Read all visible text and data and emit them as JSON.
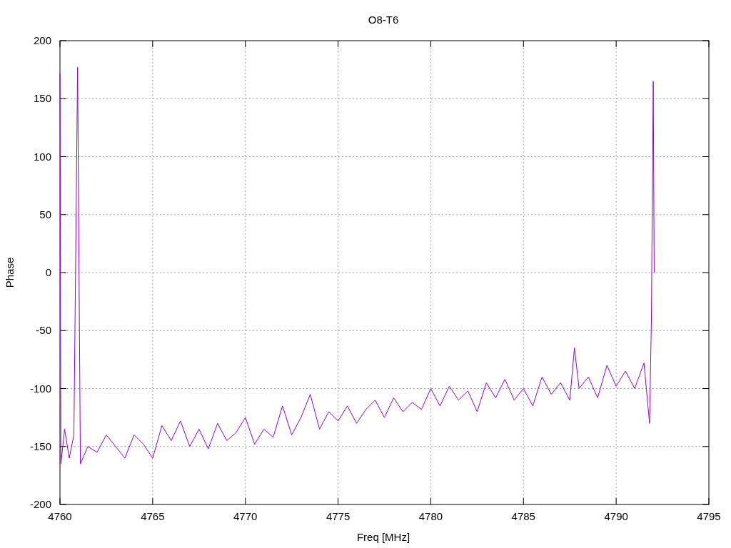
{
  "chart_data": {
    "type": "line",
    "title": "O8-T6",
    "xlabel": "Freq [MHz]",
    "ylabel": "Phase",
    "xlim": [
      4760,
      4795
    ],
    "ylim": [
      -200,
      200
    ],
    "grid": true,
    "xticks": [
      4760,
      4765,
      4770,
      4775,
      4780,
      4785,
      4790,
      4795
    ],
    "yticks": [
      -200,
      -150,
      -100,
      -50,
      0,
      50,
      100,
      150,
      200
    ],
    "x": [
      4760,
      4760.05,
      4760.25,
      4760.5,
      4760.75,
      4760.95,
      4761.1,
      4761.5,
      4762,
      4762.5,
      4763,
      4763.5,
      4764,
      4764.5,
      4765,
      4765.5,
      4766,
      4766.5,
      4767,
      4767.5,
      4768,
      4768.5,
      4769,
      4769.5,
      4770,
      4770.5,
      4771,
      4771.5,
      4772,
      4772.5,
      4773,
      4773.5,
      4774,
      4774.5,
      4775,
      4775.5,
      4776,
      4776.5,
      4777,
      4777.5,
      4778,
      4778.5,
      4779,
      4779.5,
      4780,
      4780.5,
      4781,
      4781.5,
      4782,
      4782.5,
      4783,
      4783.5,
      4784,
      4784.5,
      4785,
      4785.5,
      4786,
      4786.5,
      4787,
      4787.5,
      4787.75,
      4788,
      4788.5,
      4789,
      4789.5,
      4790,
      4790.5,
      4791,
      4791.5,
      4791.8,
      4791.9,
      4792,
      4792.05
    ],
    "series": [
      {
        "color": "#9400d3",
        "values": [
          172,
          -165,
          -135,
          -160,
          -140,
          177,
          -165,
          -150,
          -155,
          -140,
          -150,
          -160,
          -140,
          -148,
          -160,
          -132,
          -145,
          -128,
          -150,
          -135,
          -152,
          -130,
          -145,
          -138,
          -125,
          -148,
          -135,
          -142,
          -115,
          -140,
          -125,
          -105,
          -135,
          -120,
          -128,
          -115,
          -130,
          -118,
          -110,
          -125,
          -108,
          -120,
          -112,
          -118,
          -100,
          -115,
          -98,
          -110,
          -102,
          -120,
          -95,
          -108,
          -92,
          -110,
          -100,
          -115,
          -90,
          -105,
          -95,
          -110,
          -65,
          -100,
          -90,
          -108,
          -80,
          -98,
          -85,
          -100,
          -78,
          -130,
          -40,
          165,
          0
        ]
      }
    ]
  }
}
